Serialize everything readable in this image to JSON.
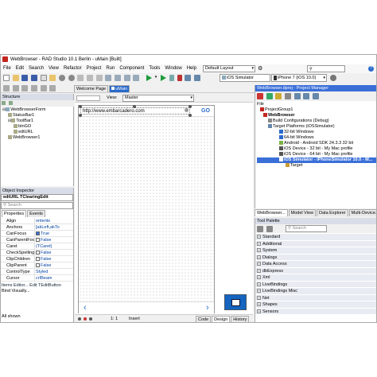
{
  "title_bar": {
    "text": "WebBrowser - RAD Studio 10.1 Berlin - uMain [Built]"
  },
  "menu": {
    "items": [
      "File",
      "Edit",
      "Search",
      "View",
      "Refactor",
      "Project",
      "Run",
      "Component",
      "Tools",
      "Window",
      "Help"
    ]
  },
  "toolbar": {
    "layout_value": "Default Layout",
    "search_placeholder": "",
    "platform_value": "iOS Simulator",
    "device_value": "iPhone 7 (iOS 10.0)"
  },
  "tabs": {
    "welcome": "Welcome Page",
    "umain": "uMain"
  },
  "designer": {
    "view_label": "View:",
    "view_value": "Master",
    "url": "http://www.embarcadero.com",
    "go_label": "GO"
  },
  "structure": {
    "header": "Structure",
    "tree": [
      "WebBrowserForm",
      "StatusBar1",
      "ToolBar1",
      "btnGO",
      "edtURL",
      "WebBrowser1"
    ]
  },
  "object_inspector": {
    "header": "Object Inspector",
    "selected": "edtURL  TClearingEdit",
    "search_placeholder": "Search",
    "tabs": [
      "Properties",
      "Events"
    ],
    "rows": [
      {
        "name": "Align",
        "value": "ontents"
      },
      {
        "name": "Anchors",
        "value": "[akLeft,akTo"
      },
      {
        "name": "CanFocus",
        "value": "True",
        "check": true
      },
      {
        "name": "CanParentFocus",
        "value": "False",
        "check": false
      },
      {
        "name": "Caret",
        "value": "(TCaret)"
      },
      {
        "name": "CheckSpelling",
        "value": "False",
        "check": false
      },
      {
        "name": "ClipChildren",
        "value": "False",
        "check": false
      },
      {
        "name": "ClipParent",
        "value": "False",
        "check": false
      },
      {
        "name": "ControlType",
        "value": "Styled"
      },
      {
        "name": "Cursor",
        "value": "crIBeam"
      }
    ],
    "footer1": "Items Editor...  Edit TEditButton",
    "footer2": "Bind Visually...",
    "status": "All shown"
  },
  "project_manager": {
    "header": "WebBrowser.dproj - Project Manager",
    "file_label": "File",
    "tree": [
      "ProjectGroup1",
      "WebBrowser",
      "Build Configurations (Debug)",
      "Target Platforms (iOSSimulator)",
      "32-bit Windows",
      "64-bit Windows",
      "Android - Android SDK 24.3.3 32 bit",
      "iOS Device - 32 bit - My Mac profile",
      "iOS Device - 64 bit - My Mac profile",
      "iOS Simulator - iPhoneSimulator 10.0 - M...",
      "Target"
    ]
  },
  "right_tabs": [
    "WebBrowser...",
    "Model View",
    "Data Explorer",
    "Multi-Device..."
  ],
  "tool_palette": {
    "header": "Tool Palette",
    "search_placeholder": "Search",
    "categories": [
      "Standard",
      "Additional",
      "System",
      "Dialogs",
      "Data Access",
      "dbExpress",
      "Xml",
      "LiveBindings",
      "LiveBindings Misc",
      "Net",
      "Shapes",
      "Sensors"
    ]
  },
  "status_bar": {
    "position": "1:  1",
    "mode": "Insert",
    "tabs": [
      "Code",
      "Design",
      "History"
    ]
  },
  "colors": {
    "selection": "#3a6fd8",
    "panel_header": "#d8dde8",
    "go_blue": "#2a6acb"
  }
}
